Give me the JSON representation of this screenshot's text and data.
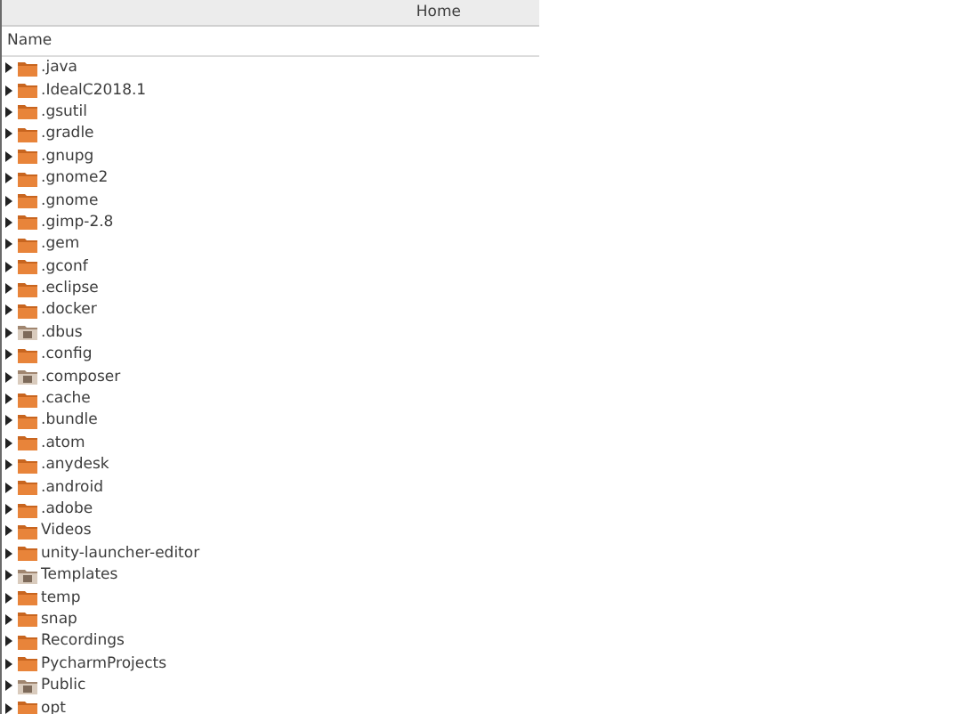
{
  "window": {
    "title": "Home"
  },
  "table": {
    "columns": [
      "Name"
    ],
    "rows": [
      {
        "name": ".java",
        "kind": "folder",
        "expanded": false
      },
      {
        "name": ".IdealC2018.1",
        "kind": "folder",
        "expanded": false
      },
      {
        "name": ".gsutil",
        "kind": "folder",
        "expanded": false
      },
      {
        "name": ".gradle",
        "kind": "folder",
        "expanded": false
      },
      {
        "name": ".gnupg",
        "kind": "folder",
        "expanded": false
      },
      {
        "name": ".gnome2",
        "kind": "folder",
        "expanded": false
      },
      {
        "name": ".gnome",
        "kind": "folder",
        "expanded": false
      },
      {
        "name": ".gimp-2.8",
        "kind": "folder",
        "expanded": false
      },
      {
        "name": ".gem",
        "kind": "folder",
        "expanded": false
      },
      {
        "name": ".gconf",
        "kind": "folder",
        "expanded": false
      },
      {
        "name": ".eclipse",
        "kind": "folder",
        "expanded": false
      },
      {
        "name": ".docker",
        "kind": "folder",
        "expanded": false
      },
      {
        "name": ".dbus",
        "kind": "special",
        "expanded": false
      },
      {
        "name": ".config",
        "kind": "folder",
        "expanded": false
      },
      {
        "name": ".composer",
        "kind": "special",
        "expanded": false
      },
      {
        "name": ".cache",
        "kind": "folder",
        "expanded": false
      },
      {
        "name": ".bundle",
        "kind": "folder",
        "expanded": false
      },
      {
        "name": ".atom",
        "kind": "folder",
        "expanded": false
      },
      {
        "name": ".anydesk",
        "kind": "folder",
        "expanded": false
      },
      {
        "name": ".android",
        "kind": "folder",
        "expanded": false
      },
      {
        "name": ".adobe",
        "kind": "folder",
        "expanded": false
      },
      {
        "name": "Videos",
        "kind": "folder",
        "expanded": false
      },
      {
        "name": "unity-launcher-editor",
        "kind": "folder",
        "expanded": false
      },
      {
        "name": "Templates",
        "kind": "special",
        "expanded": false
      },
      {
        "name": "temp",
        "kind": "folder",
        "expanded": false
      },
      {
        "name": "snap",
        "kind": "folder",
        "expanded": false
      },
      {
        "name": "Recordings",
        "kind": "folder",
        "expanded": false
      },
      {
        "name": "PycharmProjects",
        "kind": "folder",
        "expanded": false
      },
      {
        "name": "Public",
        "kind": "special",
        "expanded": false
      },
      {
        "name": "opt",
        "kind": "folder",
        "expanded": false
      }
    ]
  }
}
